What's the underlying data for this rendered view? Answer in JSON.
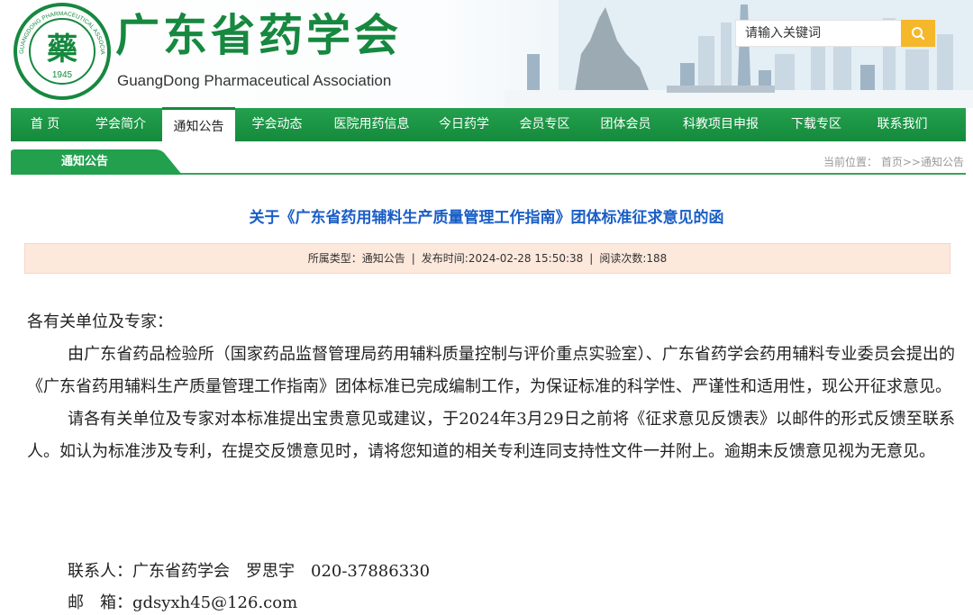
{
  "header": {
    "seal_year": "1945",
    "seal_glyph": "藥",
    "seal_ring_text": "GUANGDONG PHARMACEUTICAL ASSOCIATION",
    "title": "广东省药学会",
    "subtitle": "GuangDong Pharmaceutical Association",
    "search_placeholder": "请输入关键词",
    "brand_green": "#16883f",
    "search_button_color": "#f5b82a",
    "search_icon": "search-icon"
  },
  "nav": {
    "items": [
      {
        "label": "首 页"
      },
      {
        "label": "学会简介"
      },
      {
        "label": "通知公告",
        "active": true
      },
      {
        "label": "学会动态"
      },
      {
        "label": "医院用药信息"
      },
      {
        "label": "今日药学"
      },
      {
        "label": "会员专区"
      },
      {
        "label": "团体会员"
      },
      {
        "label": "科教项目申报"
      },
      {
        "label": "下载专区"
      },
      {
        "label": "联系我们"
      }
    ]
  },
  "subbar": {
    "section": "通知公告",
    "crumb_label": "当前位置：",
    "crumb_path": "首页>>通知公告"
  },
  "article": {
    "title": "关于《广东省药用辅料生产质量管理工作指南》团体标准征求意见的函",
    "meta_type": "所属类型：通知公告",
    "meta_time": "发布时间:2024-02-28 15:50:38",
    "meta_views": "阅读次数:188",
    "salutation": "各有关单位及专家：",
    "para1": "由广东省药品检验所（国家药品监督管理局药用辅料质量控制与评价重点实验室）、广东省药学会药用辅料专业委员会提出的《广东省药用辅料生产质量管理工作指南》团体标准已完成编制工作，为保证标准的科学性、严谨性和适用性，现公开征求意见。",
    "para2": "请各有关单位及专家对本标准提出宝贵意见或建议，于2024年3月29日之前将《征求意见反馈表》以邮件的形式反馈至联系人。如认为标准涉及专利，在提交反馈意见时，请将您知道的相关专利连同支持性文件一并附上。逾期未反馈意见视为无意见。",
    "contact_line": "联系人：广东省药学会　罗思宇　020-37886330",
    "email_line": "邮　箱：gdsyxh45@126.com"
  }
}
